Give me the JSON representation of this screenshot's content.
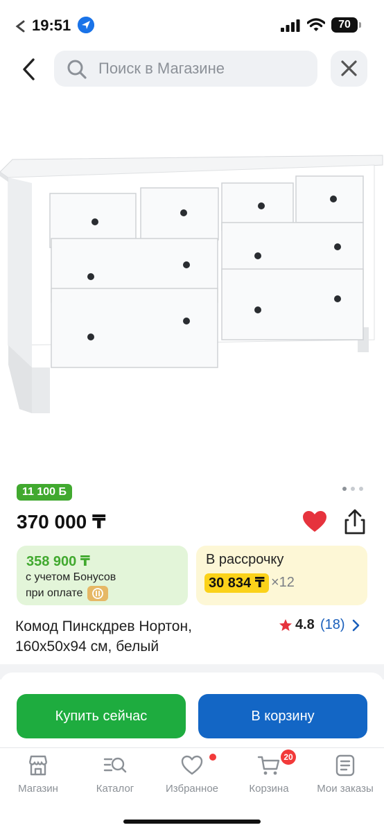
{
  "status_bar": {
    "time": "19:51",
    "battery": "70"
  },
  "search": {
    "placeholder": "Поиск в Магазине"
  },
  "product": {
    "bonus_badge": "11 100 Б",
    "price": "370 000 ₸",
    "bonus_card": {
      "price": "358 900 ₸",
      "line1": "с учетом Бонусов",
      "line2": "при оплате"
    },
    "installment_card": {
      "title": "В рассрочку",
      "amount": "30 834 ₸",
      "multiplier": "×12"
    },
    "title": "Комод Пинскдрев Нортон, 160х50х94 см, белый",
    "rating": "4.8",
    "reviews": "(18)",
    "is_favorite": true
  },
  "actions": {
    "buy_label": "Купить сейчас",
    "cart_label": "В корзину"
  },
  "tab_bar": {
    "items": [
      {
        "label": "Магазин",
        "icon": "store-icon"
      },
      {
        "label": "Каталог",
        "icon": "catalog-search-icon"
      },
      {
        "label": "Избранное",
        "icon": "heart-outline-icon"
      },
      {
        "label": "Корзина",
        "icon": "cart-icon",
        "badge": "20"
      },
      {
        "label": "Мои заказы",
        "icon": "orders-icon"
      }
    ]
  },
  "colors": {
    "green": "#41a92f",
    "buy_button": "#1eac3f",
    "cart_button": "#1366c5",
    "installment_highlight": "#fbd21a",
    "favorite_red": "#e6333d"
  }
}
